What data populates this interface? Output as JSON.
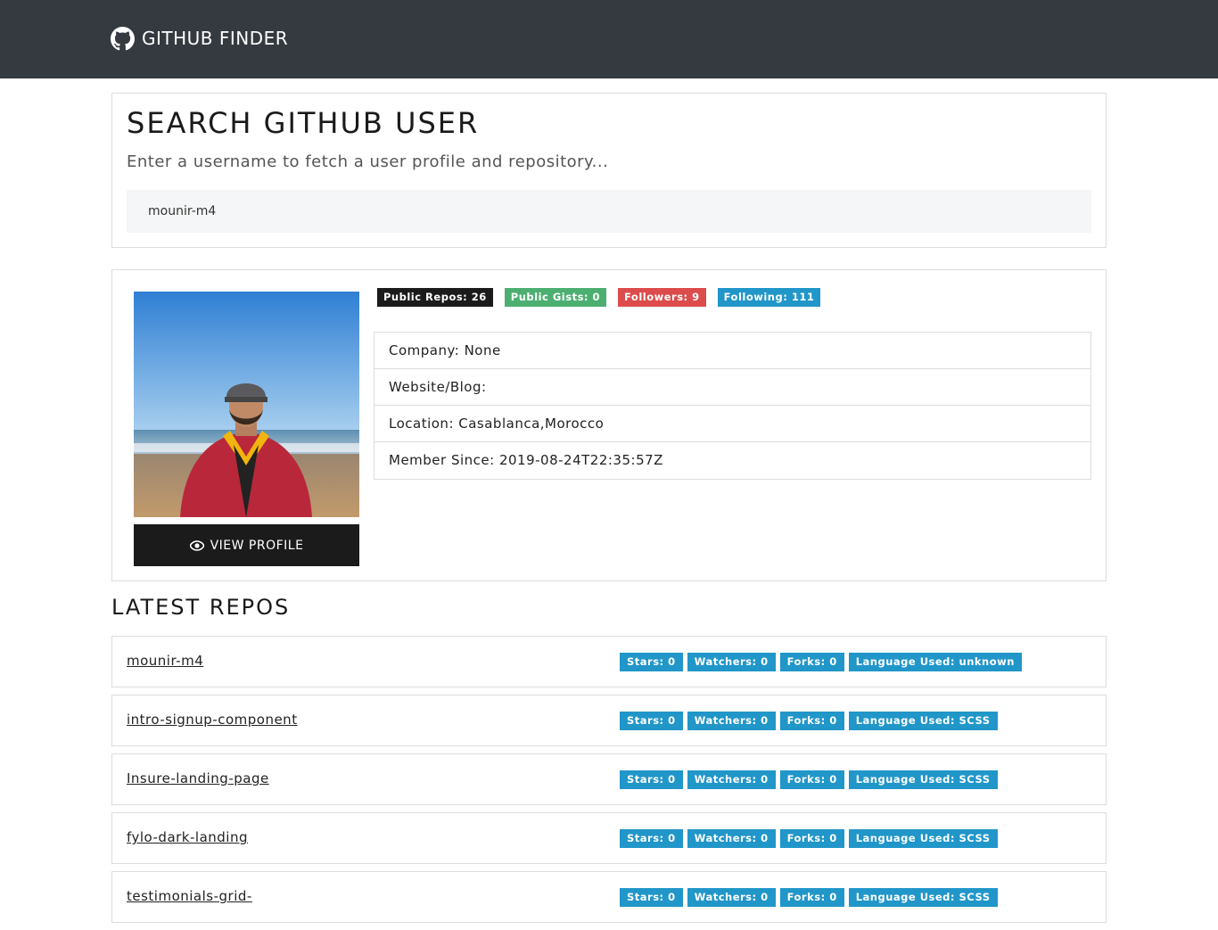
{
  "brand": {
    "name": "GITHUB FINDER",
    "icon": "github-icon"
  },
  "search": {
    "title": "SEARCH GITHUB USER",
    "subtitle": "Enter a username to fetch a user profile and repository...",
    "value": "mounir-m4"
  },
  "profile": {
    "view_button_label": "VIEW PROFILE",
    "view_button_icon": "eye-icon",
    "badges": {
      "public_repos": "Public Repos: 26",
      "public_gists": "Public Gists: 0",
      "followers": "Followers: 9",
      "following": "Following: 111"
    },
    "info": {
      "company": "Company: None",
      "website": "Website/Blog:",
      "location": "Location: Casablanca,Morocco",
      "member_since": "Member Since: 2019-08-24T22:35:57Z"
    }
  },
  "repos": {
    "title": "LATEST REPOS",
    "items": [
      {
        "name": "mounir-m4",
        "stars": "Stars: 0",
        "watchers": "Watchers: 0",
        "forks": "Forks: 0",
        "language": "Language Used: unknown"
      },
      {
        "name": "intro-signup-component",
        "stars": "Stars: 0",
        "watchers": "Watchers: 0",
        "forks": "Forks: 0",
        "language": "Language Used: SCSS"
      },
      {
        "name": "Insure-landing-page",
        "stars": "Stars: 0",
        "watchers": "Watchers: 0",
        "forks": "Forks: 0",
        "language": "Language Used: SCSS"
      },
      {
        "name": "fylo-dark-landing",
        "stars": "Stars: 0",
        "watchers": "Watchers: 0",
        "forks": "Forks: 0",
        "language": "Language Used: SCSS"
      },
      {
        "name": "testimonials-grid-",
        "stars": "Stars: 0",
        "watchers": "Watchers: 0",
        "forks": "Forks: 0",
        "language": "Language Used: SCSS"
      }
    ]
  },
  "colors": {
    "navbar": "#343a40",
    "badge_dark": "#1b1b1b",
    "badge_green": "#4caf71",
    "badge_red": "#dc4c4c",
    "badge_blue": "#2196c9"
  }
}
